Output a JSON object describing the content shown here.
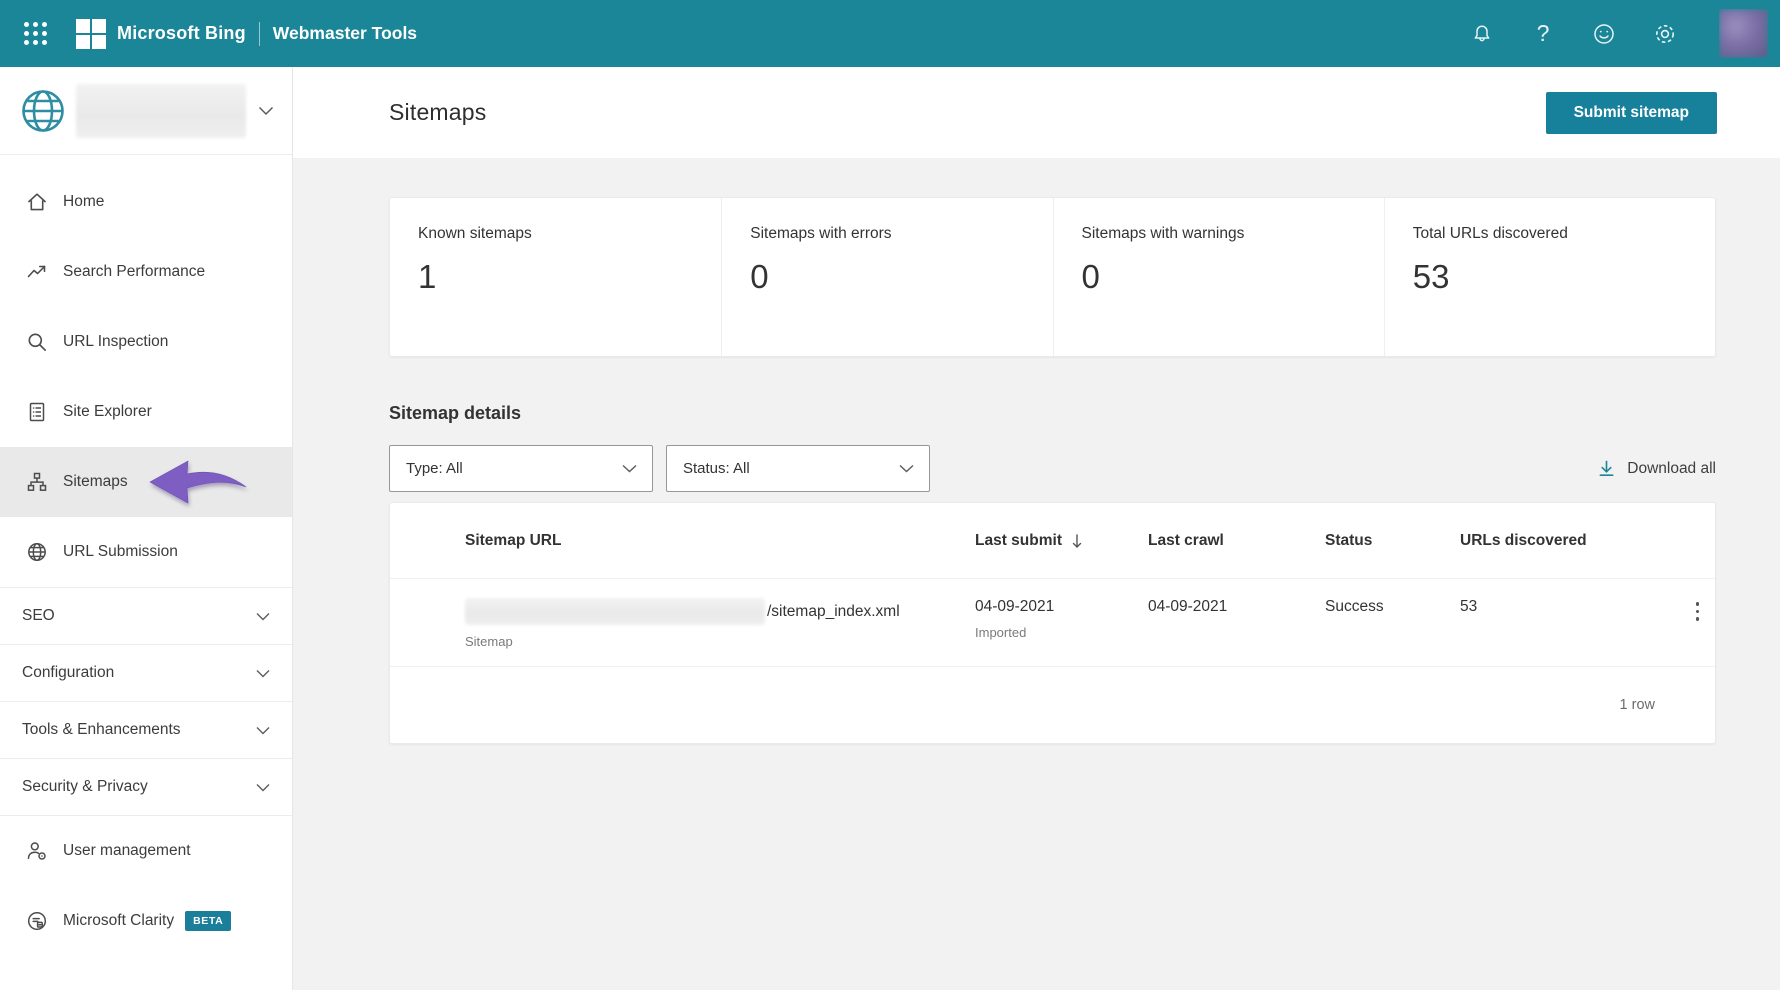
{
  "colors": {
    "topbar_accent": "#1b8698",
    "button_accent": "#17819b",
    "active_item_bg": "#e9e9e9",
    "annotation_arrow": "#7e5ec2",
    "page_bg": "#f2f2f2"
  },
  "topbar": {
    "brand": "Microsoft Bing",
    "product": "Webmaster Tools",
    "left_icon": "app-launcher-icon",
    "right_icons": [
      "notifications-icon",
      "help-icon",
      "feedback-icon",
      "settings-icon"
    ],
    "help_glyph": "?",
    "avatar_redacted": true
  },
  "sidebar": {
    "site_selector": {
      "icon": "globe-icon",
      "chevron": "chevron-down-icon",
      "site_name_redacted": true
    },
    "items": [
      {
        "label": "Home",
        "icon": "home-icon"
      },
      {
        "label": "Search Performance",
        "icon": "trending-up-icon"
      },
      {
        "label": "URL Inspection",
        "icon": "search-icon"
      },
      {
        "label": "Site Explorer",
        "icon": "site-explorer-icon"
      },
      {
        "label": "Sitemaps",
        "icon": "sitemap-icon",
        "active": true,
        "annotation": "purple-arrow"
      },
      {
        "label": "URL Submission",
        "icon": "globe-outline-icon"
      }
    ],
    "sections": [
      {
        "label": "SEO"
      },
      {
        "label": "Configuration"
      },
      {
        "label": "Tools & Enhancements"
      },
      {
        "label": "Security & Privacy"
      }
    ],
    "footer_items": [
      {
        "label": "User management",
        "icon": "user-icon"
      },
      {
        "label": "Microsoft Clarity",
        "icon": "clarity-icon",
        "badge": "BETA"
      }
    ]
  },
  "page": {
    "title": "Sitemaps",
    "submit_button_label": "Submit sitemap"
  },
  "stats": {
    "cards": [
      {
        "label": "Known sitemaps",
        "value": "1"
      },
      {
        "label": "Sitemaps with errors",
        "value": "0"
      },
      {
        "label": "Sitemaps with warnings",
        "value": "0"
      },
      {
        "label": "Total URLs discovered",
        "value": "53"
      }
    ]
  },
  "sitemap_details": {
    "heading": "Sitemap details",
    "type_filter_value": "Type: All",
    "status_filter_value": "Status: All",
    "download_all_label": "Download all"
  },
  "table": {
    "columns": [
      "Sitemap URL",
      "Last submit",
      "Last crawl",
      "Status",
      "URLs discovered"
    ],
    "sorted_by": "Last submit",
    "sort_direction": "descending",
    "rows": [
      {
        "url_redacted": true,
        "url_suffix": "/sitemap_index.xml",
        "type_label": "Sitemap",
        "last_submit": "04-09-2021",
        "last_submit_note": "Imported",
        "last_crawl": "04-09-2021",
        "status": "Success",
        "urls_discovered": "53"
      }
    ],
    "footer": "1 row"
  }
}
